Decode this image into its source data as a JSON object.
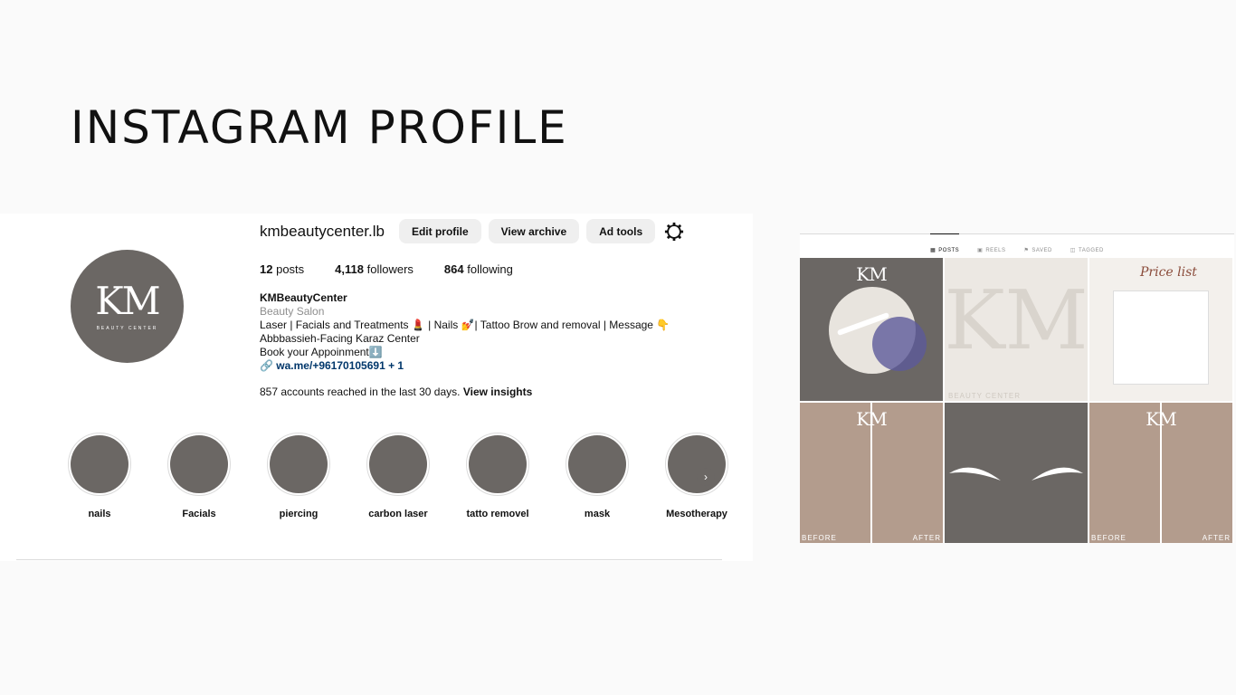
{
  "slide_title": "INSTAGRAM PROFILE",
  "profile": {
    "avatar_text": "KM",
    "avatar_subtext": "BEAUTY CENTER",
    "username": "kmbeautycenter.lb",
    "buttons": {
      "edit": "Edit profile",
      "archive": "View archive",
      "adtools": "Ad tools"
    },
    "stats": {
      "posts_count": "12",
      "posts_label": "posts",
      "followers_count": "4,118",
      "followers_label": "followers",
      "following_count": "864",
      "following_label": "following"
    },
    "bio": {
      "name": "KMBeautyCenter",
      "category": "Beauty Salon",
      "line1": "Laser | Facials and Treatments 💄 | Nails 💅| Tattoo Brow and removal | Message 👇",
      "line2": "Abbbassieh-Facing Karaz Center",
      "line3": "Book your Appoinment⬇️",
      "link": "wa.me/+96170105691 + 1"
    },
    "insights_text": "857 accounts reached in the last 30 days.",
    "insights_link": "View insights",
    "highlights": [
      "nails",
      "Facials",
      "piercing",
      "carbon laser",
      "tatto removel",
      "mask",
      "Mesotherapy"
    ]
  },
  "grid": {
    "tabs": [
      "POSTS",
      "REELS",
      "SAVED",
      "TAGGED"
    ],
    "post_mark": "KM",
    "before_label": "BEFORE",
    "after_label": "AFTER",
    "post3_title": "Price list",
    "post2_caption": "BEAUTY CENTER"
  },
  "colors": {
    "brand_gray": "#6b6764",
    "link": "#00376b",
    "muted": "#8e8e8e"
  }
}
